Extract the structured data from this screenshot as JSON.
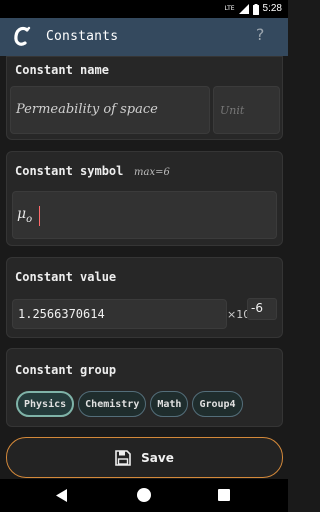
{
  "status_bar": {
    "network": "LTE",
    "time": "5:28"
  },
  "app_bar": {
    "title": "Constants",
    "help": "?"
  },
  "name_section": {
    "label": "Constant name",
    "name_value": "Permeability of space",
    "unit_placeholder": "Unit"
  },
  "symbol_section": {
    "label": "Constant symbol",
    "max_hint": "max=6",
    "symbol_main": "μ",
    "symbol_sub": "o"
  },
  "value_section": {
    "label": "Constant value",
    "value": "1.2566370614",
    "times_ten": "×10",
    "exponent": "-6"
  },
  "group_section": {
    "label": "Constant group",
    "chips": [
      {
        "label": "Physics",
        "selected": true
      },
      {
        "label": "Chemistry",
        "selected": false
      },
      {
        "label": "Math",
        "selected": false
      },
      {
        "label": "Group4",
        "selected": false
      }
    ]
  },
  "save_button": {
    "label": "Save"
  },
  "colors": {
    "app_bar": "#34495e",
    "save_border": "#d4893a",
    "chip_selected_border": "#7fb3a8",
    "caret": "#ff6b6b"
  },
  "icons": {
    "logo": "calculator-c-logo-icon",
    "save": "floppy-save-icon",
    "back": "nav-back-icon",
    "home": "nav-home-icon",
    "recent": "nav-recent-icon"
  }
}
